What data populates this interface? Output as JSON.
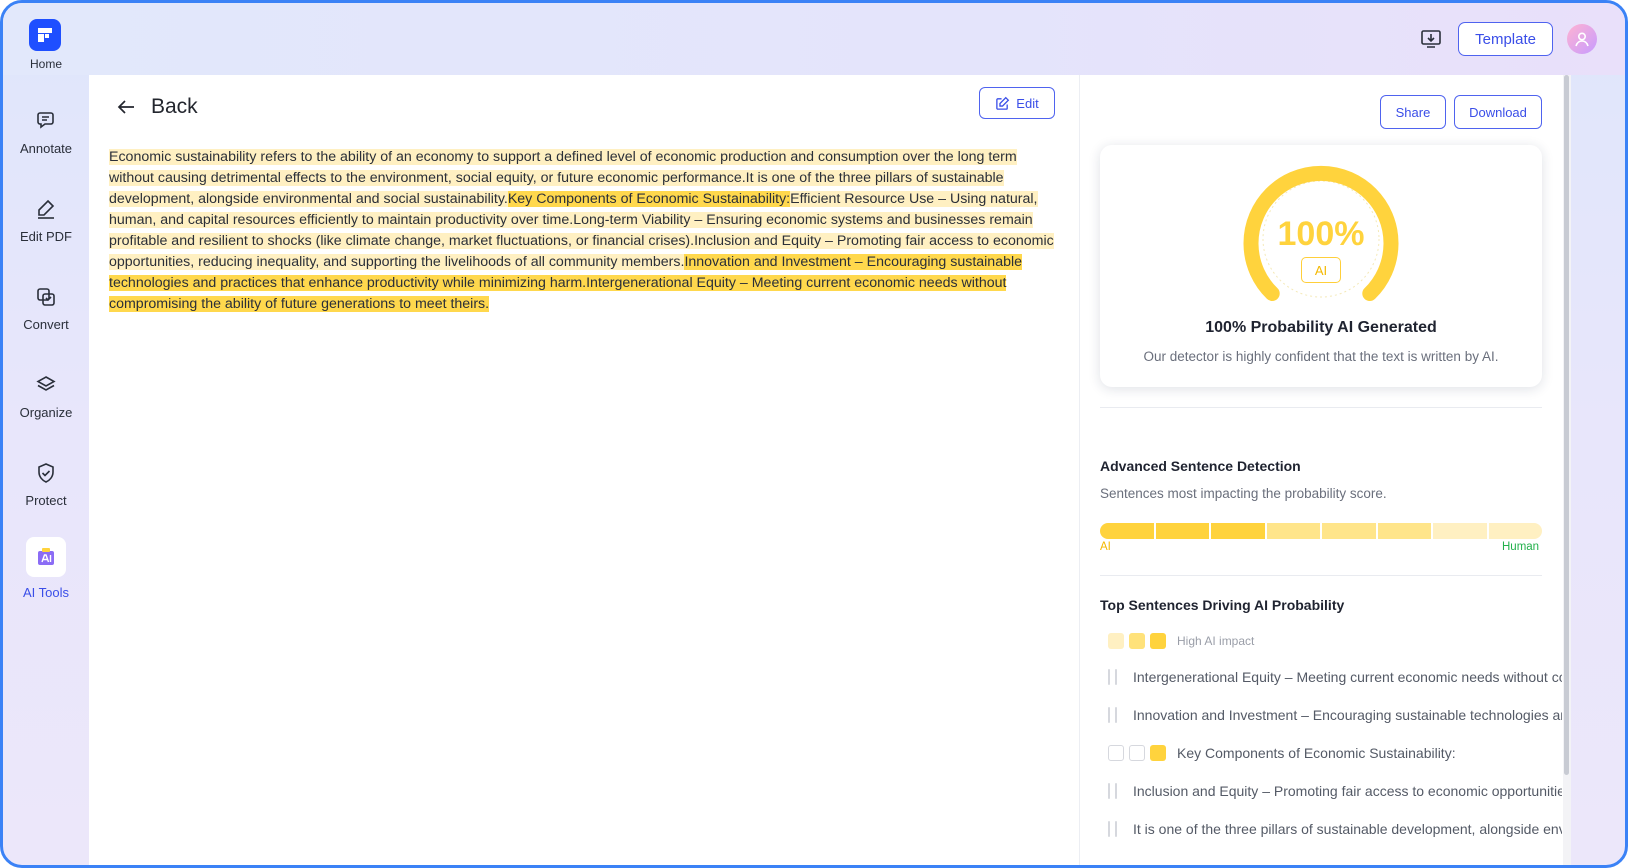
{
  "app": {
    "nav": {
      "home_label": "Home",
      "items": [
        {
          "label": "Annotate",
          "icon": "annotate-icon"
        },
        {
          "label": "Edit PDF",
          "icon": "edit-pdf-icon"
        },
        {
          "label": "Convert",
          "icon": "convert-icon"
        },
        {
          "label": "Organize",
          "icon": "organize-icon"
        },
        {
          "label": "Protect",
          "icon": "protect-icon"
        },
        {
          "label": "AI Tools",
          "icon": "ai-tools-icon",
          "active": true
        }
      ]
    },
    "topbar": {
      "template_label": "Template"
    }
  },
  "main": {
    "back_label": "Back",
    "edit_label": "Edit",
    "document": {
      "segments": [
        {
          "text": "Economic sustainability refers to the ability of an economy to support a defined level of economic production and consumption over the long term without causing detrimental effects to the environment, social equity, or future economic performance.",
          "level": "light"
        },
        {
          "text": "It is one of the three pillars of sustainable development, alongside environmental and social sustainability.",
          "level": "light"
        },
        {
          "text": "Key Components of Economic Sustainability:",
          "level": "strong"
        },
        {
          "text": "Efficient Resource Use – Using natural, human, and capital resources efficiently to maintain productivity over time.",
          "level": "light"
        },
        {
          "text": "Long-term Viability – Ensuring economic systems and businesses remain profitable and resilient to shocks (like climate change, market fluctuations, or financial crises).",
          "level": "light"
        },
        {
          "text": "Inclusion and Equity – Promoting fair access to economic opportunities, reducing inequality, and supporting the livelihoods of all community members.",
          "level": "light"
        },
        {
          "text": "Innovation and Investment – Encouraging sustainable technologies and practices that enhance productivity while minimizing harm.",
          "level": "strong"
        },
        {
          "text": "Intergenerational Equity – Meeting current economic needs without compromising the ability of future generations to meet theirs.",
          "level": "strong"
        }
      ]
    }
  },
  "panel": {
    "share_label": "Share",
    "download_label": "Download",
    "score": {
      "percent_label": "100%",
      "percent_value": 100,
      "badge": "AI",
      "title": "100%  Probability AI Generated",
      "description": "Our detector is highly confident that the text is written by AI."
    },
    "advanced": {
      "title": "Advanced Sentence Detection",
      "description": "Sentences most impacting the probability score.",
      "segments": [
        "#ffd33d",
        "#ffd33d",
        "#ffd33d",
        "#ffe58a",
        "#ffe58a",
        "#ffe58a",
        "#fff0c2",
        "#fff0c2"
      ],
      "left_label": "AI",
      "right_label": "Human"
    },
    "top_sentences": {
      "title": "Top Sentences Driving AI Probability",
      "legend_label": "High AI impact",
      "items": [
        {
          "text": "Intergenerational Equity – Meeting current economic needs without compromising the ability of future generations to meet theirs."
        },
        {
          "text": "Innovation and Investment – Encouraging sustainable technologies and practices that enhance productivity while minimizing harm."
        },
        {
          "text": "Key Components of Economic Sustainability:"
        },
        {
          "text": "Inclusion and Equity – Promoting fair access to economic opportunities, reducing inequality, and supporting the livelihoods of all community members."
        },
        {
          "text": "It is one of the three pillars of sustainable development, alongside environmental and social sustainability."
        }
      ]
    }
  },
  "colors": {
    "accent": "#3a4ee8",
    "ai_yellow": "#ffd33d",
    "human_green": "#22b04c"
  }
}
